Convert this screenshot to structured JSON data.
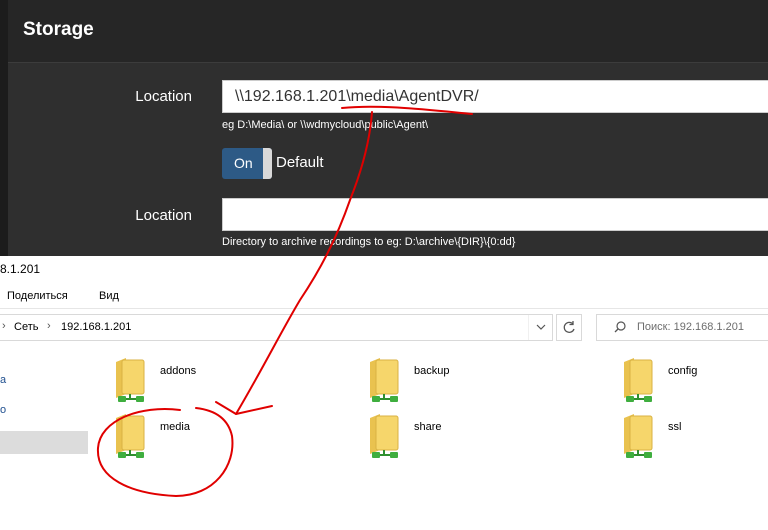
{
  "dialog": {
    "title": "Storage",
    "location_label": "Location",
    "location_value": "\\\\192.168.1.201\\media\\AgentDVR/",
    "location_hint": "eg D:\\Media\\ or \\\\wdmycloud\\public\\Agent\\",
    "toggle_state": "On",
    "toggle_label": "Default",
    "archive_label": "Location",
    "archive_value": "",
    "archive_hint": "Directory to archive recordings to eg: D:\\archive\\{DIR}\\{0:dd}"
  },
  "explorer": {
    "title": "8.1.201",
    "menu": [
      "Поделиться",
      "Вид"
    ],
    "breadcrumb": [
      "Сеть",
      "192.168.1.201"
    ],
    "search_placeholder": "Поиск: 192.168.1.201",
    "nav_fragments": [
      "а",
      "о"
    ],
    "shares": [
      "addons",
      "backup",
      "config",
      "media",
      "share",
      "ssl"
    ]
  },
  "colors": {
    "dialog_bg": "#2f2f2f",
    "dialog_header_bg": "#262626",
    "toggle_on": "#2d5a86",
    "annotation_red": "#e00000",
    "folder_yellow": "#f6d66b",
    "net_green": "#3fae3f"
  },
  "icons": {
    "share_icon": "network-share-folder-icon",
    "refresh": "refresh-icon",
    "search": "search-icon"
  }
}
